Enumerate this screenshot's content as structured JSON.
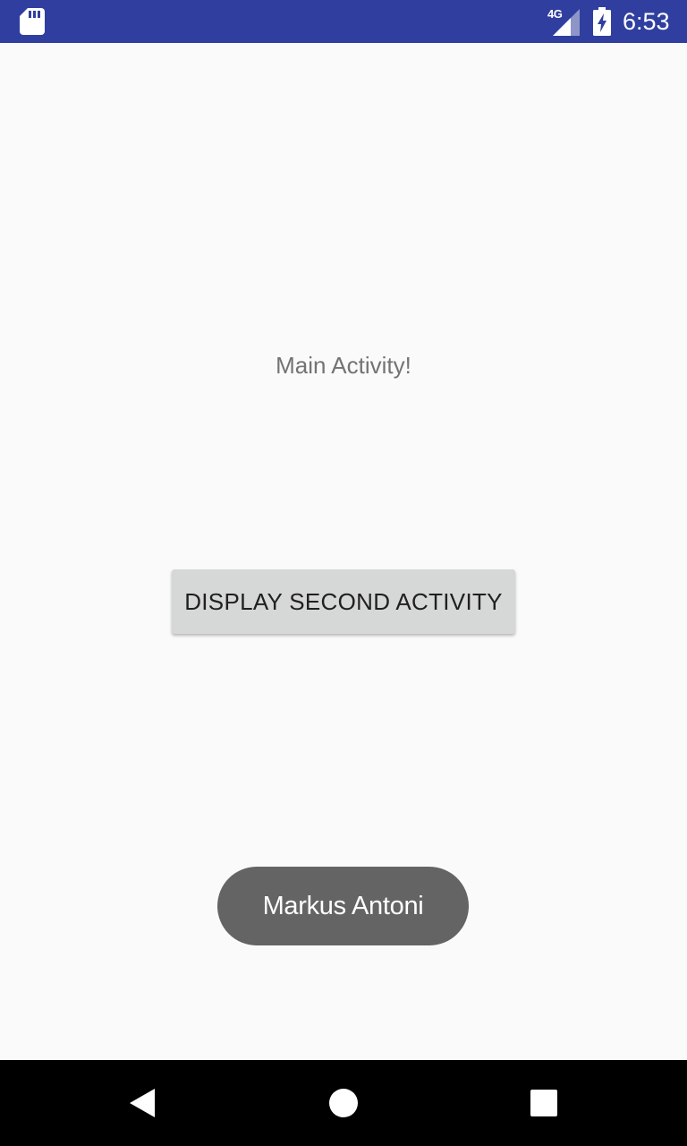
{
  "status_bar": {
    "network_type": "4G",
    "time": "6:53",
    "icons": [
      "sd-card-icon",
      "signal-icon",
      "battery-charging-icon"
    ]
  },
  "main": {
    "label": "Main Activity!",
    "button_label": "DISPLAY SECOND ACTIVITY"
  },
  "toast": {
    "message": "Markus Antoni"
  },
  "nav_bar": {
    "icons": [
      "back-icon",
      "home-icon",
      "recent-apps-icon"
    ]
  },
  "colors": {
    "status_bar": "#303f9f",
    "background": "#fafafa",
    "button": "#d6d7d7",
    "toast": "#646464",
    "nav_bar": "#000000"
  }
}
